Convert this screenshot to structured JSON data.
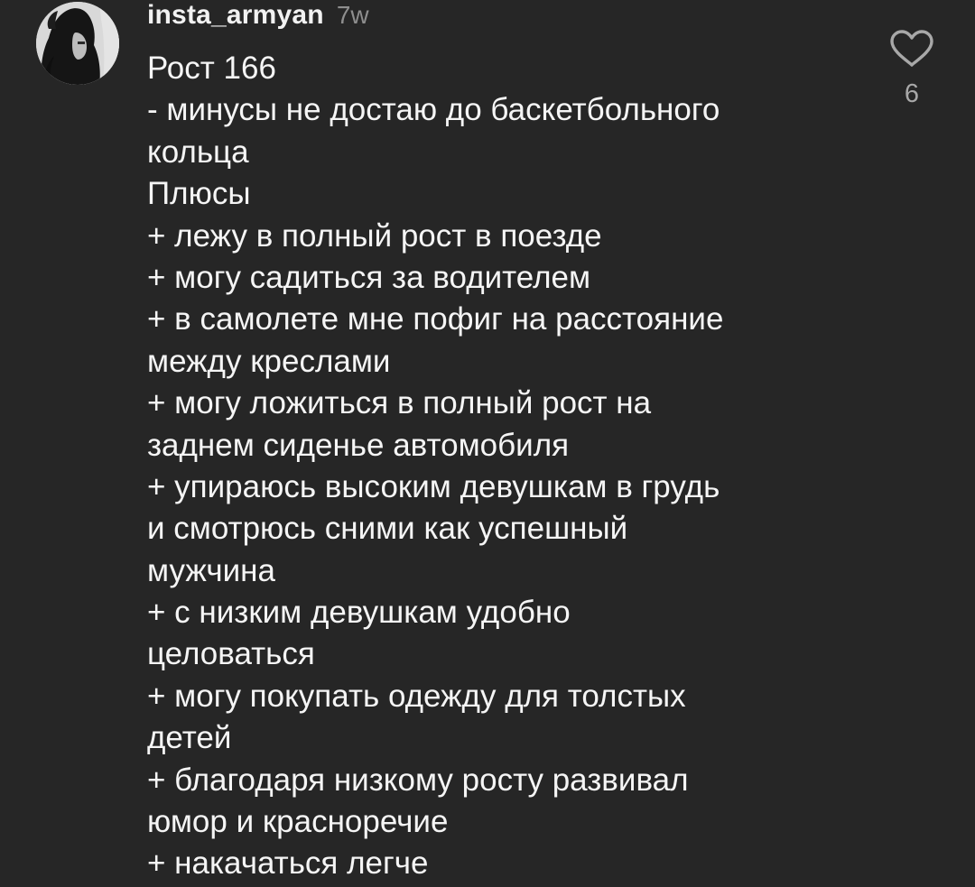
{
  "comment": {
    "username": "insta_armyan",
    "timestamp": "7w",
    "lines": [
      "Рост 166",
      "- минусы не достаю до баскетбольного",
      "кольца",
      "Плюсы",
      "+ лежу в полный рост в поезде",
      "+ могу садиться за водителем",
      "+ в самолете мне пофиг на расстояние",
      "между креслами",
      "+ могу ложиться в полный рост на",
      "заднем сиденье автомобиля",
      "+ упираюсь высоким девушкам в грудь",
      "и смотрюсь сними как успешный",
      "мужчина",
      "+ с низким девушкам удобно",
      "целоваться",
      "+ могу покупать одежду для толстых",
      "детей",
      "+ благодаря низкому росту развивал",
      "юмор и красноречие",
      "+ накачаться легче"
    ],
    "like_count": "6",
    "like_icon": "heart-outline-icon"
  },
  "colors": {
    "background": "#262626",
    "text": "#f5f5f5",
    "muted": "#8e8e8e",
    "icon": "#a8a8a8"
  }
}
